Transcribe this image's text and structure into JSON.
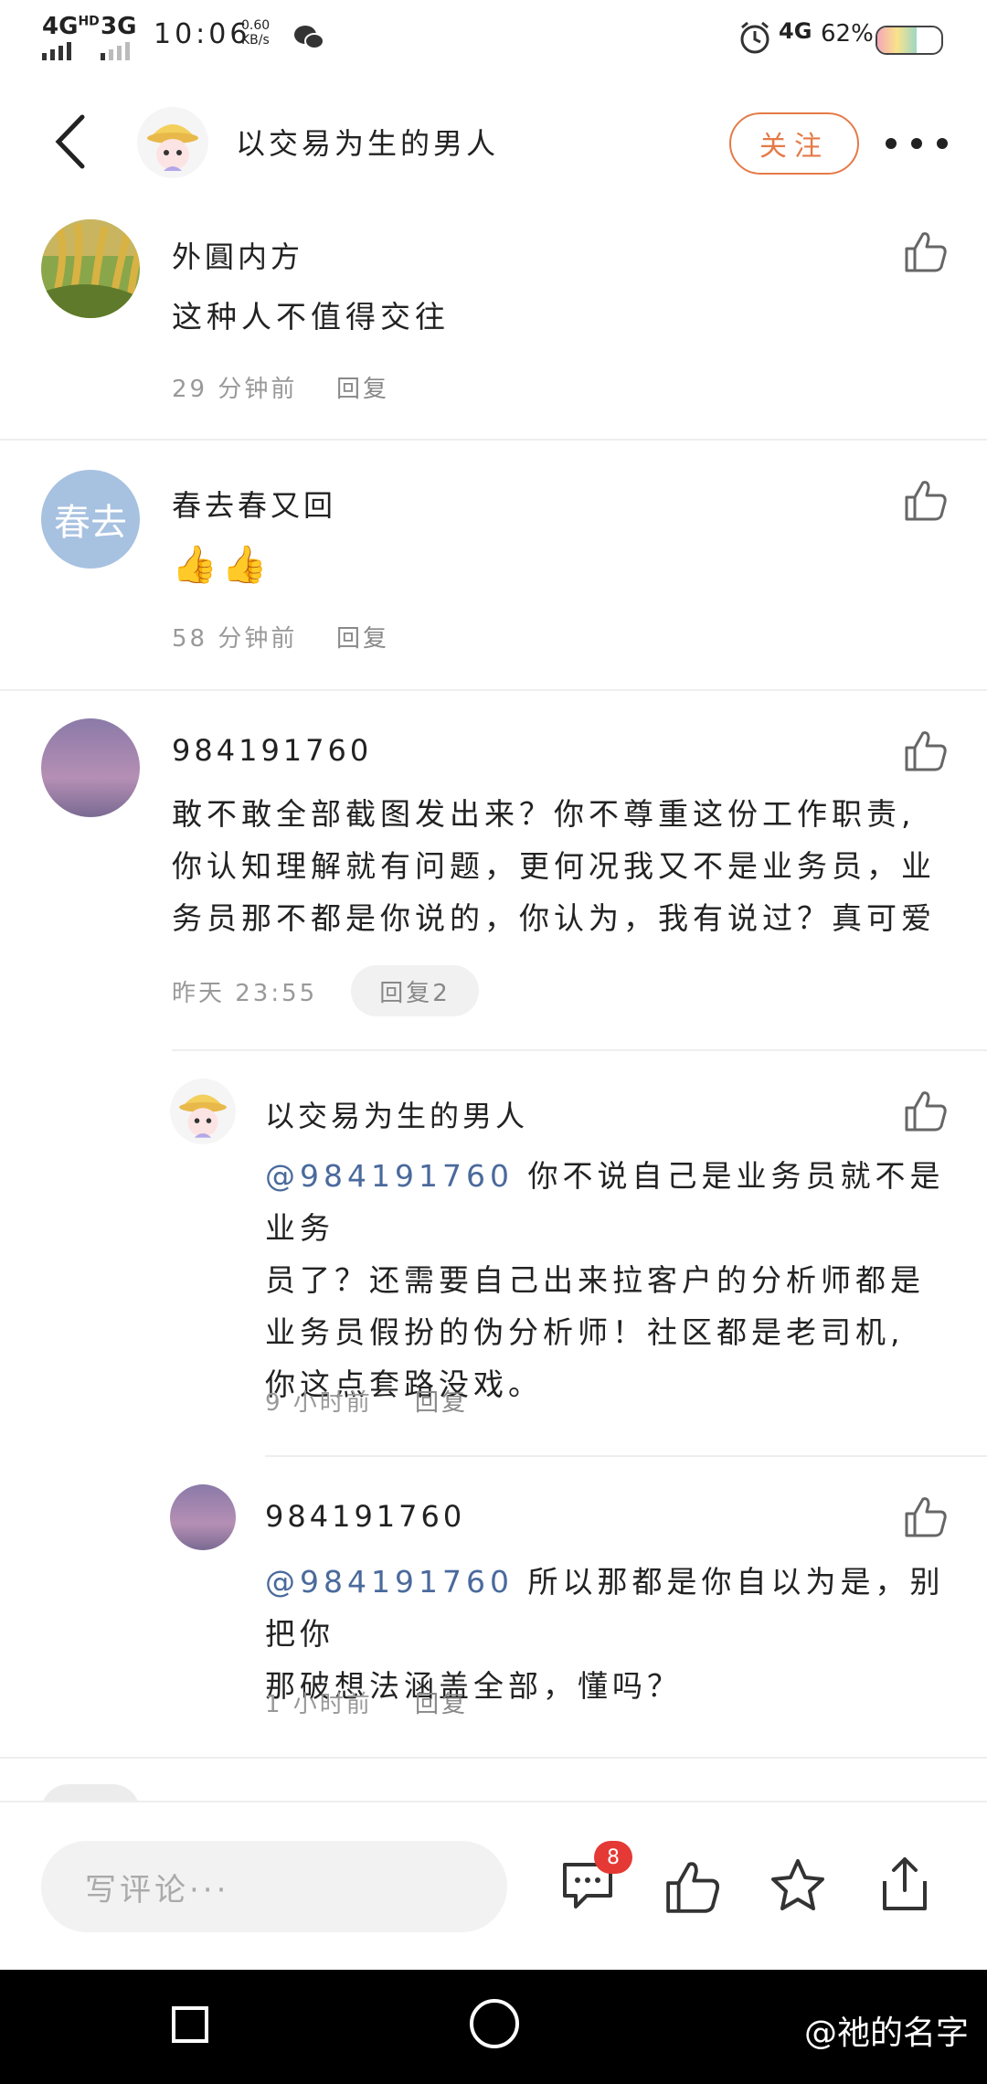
{
  "status_bar": {
    "network_left": "4G",
    "network_left_sup": "HD",
    "network_mid": "3G",
    "time": "10:06",
    "speed_value": "0.60",
    "speed_unit": "KB/s",
    "network_right": "4G",
    "battery_percent": "62%",
    "icons": [
      "wechat-icon",
      "alarm-icon",
      "battery-icon"
    ]
  },
  "header": {
    "title": "以交易为生的男人",
    "follow_label": "关注",
    "icons": [
      "back-icon",
      "more-icon"
    ]
  },
  "comments": [
    {
      "name": "外圓内方",
      "body": "这种人不值得交往",
      "time": "29 分钟前",
      "reply_label": "回复",
      "avatar": "wheat-field"
    },
    {
      "name": "春去春又回",
      "body": "👍👍",
      "time": "58 分钟前",
      "reply_label": "回复",
      "avatar_text": "春去"
    },
    {
      "name": "984191760",
      "body_lines": [
        "敢不敢全部截图发出来？你不尊重这份工作职责,",
        "你认知理解就有问题，更何况我又不是业务员，业",
        "务员那不都是你说的，你认为，我有说过？真可爱"
      ],
      "time": "昨天 23:55",
      "reply_label": "回复2",
      "avatar": "purple-sky"
    }
  ],
  "replies": [
    {
      "name": "以交易为生的男人",
      "mention": "@984191760",
      "body_lines": [
        " 你不说自己是业务员就不是业务",
        "员了？还需要自己出来拉客户的分析师都是",
        "业务员假扮的伪分析师！社区都是老司机,",
        "你这点套路没戏。"
      ],
      "time": "9 小时前",
      "reply_label": "回复"
    },
    {
      "name": "984191760",
      "mention": "@984191760",
      "body_lines": [
        " 所以那都是你自以为是，别把你",
        "那破想法涵盖全部，懂吗？"
      ],
      "time": "1 小时前",
      "reply_label": "回复"
    }
  ],
  "bottom_bar": {
    "input_placeholder": "写评论···",
    "comment_count": "8",
    "icons": [
      "comment-icon",
      "like-icon",
      "star-icon",
      "share-icon"
    ]
  },
  "nav_bar": {
    "watermark": "@祂的名字"
  },
  "colors": {
    "accent": "#e57a47",
    "mention": "#4a6a9c",
    "badge": "#e53935",
    "meta_text": "#999999"
  }
}
